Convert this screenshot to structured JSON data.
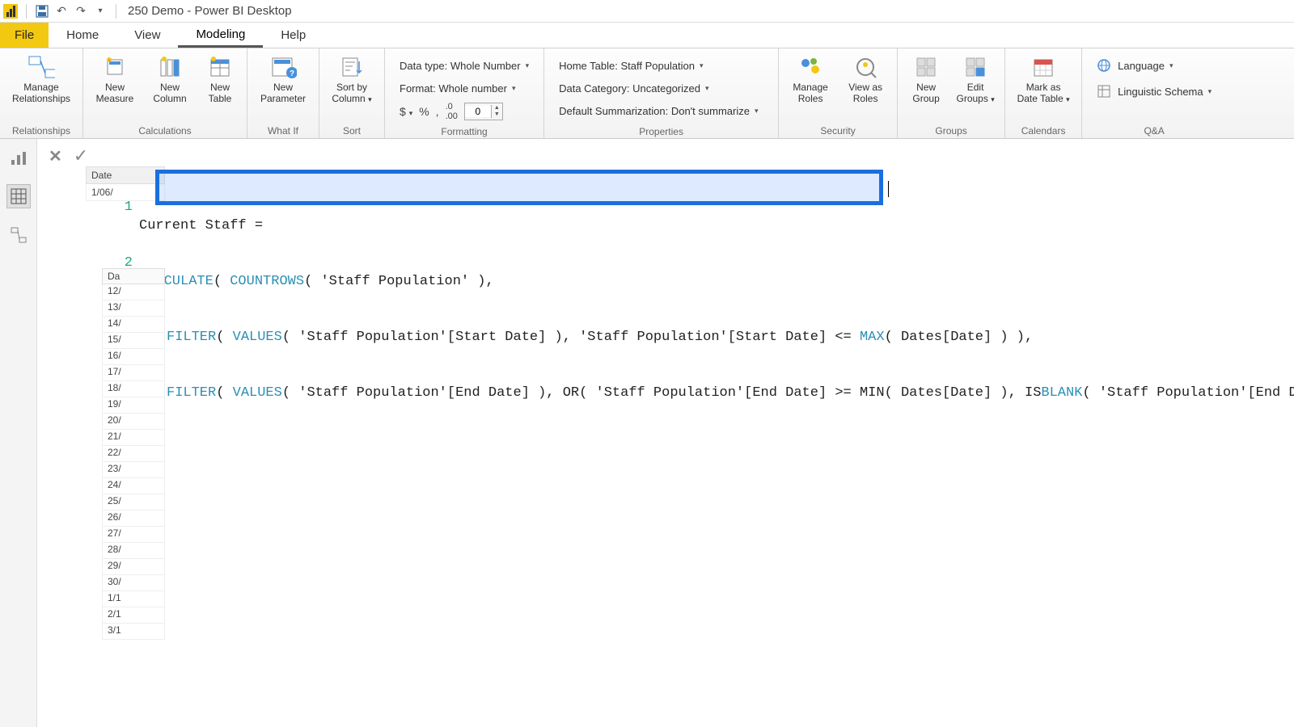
{
  "titlebar": {
    "title": "250 Demo - Power BI Desktop"
  },
  "menu": {
    "file": "File",
    "home": "Home",
    "view": "View",
    "modeling": "Modeling",
    "help": "Help"
  },
  "ribbon": {
    "relationships": {
      "manage": "Manage\nRelationships",
      "group": "Relationships"
    },
    "calculations": {
      "measure": "New\nMeasure",
      "column": "New\nColumn",
      "table": "New\nTable",
      "group": "Calculations"
    },
    "whatif": {
      "param": "New\nParameter",
      "group": "What If"
    },
    "sort": {
      "sortby": "Sort by\nColumn",
      "group": "Sort"
    },
    "formatting": {
      "datatype": "Data type: Whole Number",
      "format": "Format: Whole number",
      "decimals": "0",
      "group": "Formatting"
    },
    "properties": {
      "hometable": "Home Table: Staff Population",
      "category": "Data Category: Uncategorized",
      "summarization": "Default Summarization: Don't summarize",
      "group": "Properties"
    },
    "security": {
      "manage": "Manage\nRoles",
      "view": "View as\nRoles",
      "group": "Security"
    },
    "groups": {
      "new": "New\nGroup",
      "edit": "Edit\nGroups",
      "group": "Groups"
    },
    "calendars": {
      "mark": "Mark as\nDate Table",
      "group": "Calendars"
    },
    "qa": {
      "lang": "Language",
      "schema": "Linguistic Schema",
      "group": "Q&A"
    }
  },
  "formula": {
    "line1": "Current Staff =",
    "line2_pre": "CALCULATE( COUNTROWS( 'Staff Population' ),",
    "line3_filter": "FILTER",
    "line3_values": "VALUES",
    "line3_arg1": "( 'Staff Population'[Start Date] ), 'Staff Population'[Start Date] <= ",
    "line3_max": "MAX",
    "line3_end": "( Dates[Date] ) ),",
    "line4_filter": "FILTER",
    "line4_values": "VALUES",
    "line4_mid": "( 'Staff Population'[End Date] ), OR( 'Staff Population'[End Date] >= MIN( Dates[Date] ), IS",
    "line4_blank": "BLANK",
    "line4_end": "( 'Staff Population'[End Date] ) ) ) )"
  },
  "peek": {
    "header": "Date",
    "cell": "1/06/",
    "col": "Da",
    "rows": [
      "12/",
      "13/",
      "14/",
      "15/",
      "16/",
      "17/",
      "18/",
      "19/",
      "20/",
      "21/",
      "22/",
      "23/",
      "24/",
      "25/",
      "26/",
      "27/",
      "28/",
      "29/",
      "30/",
      "1/1",
      "2/1",
      "3/1"
    ]
  }
}
